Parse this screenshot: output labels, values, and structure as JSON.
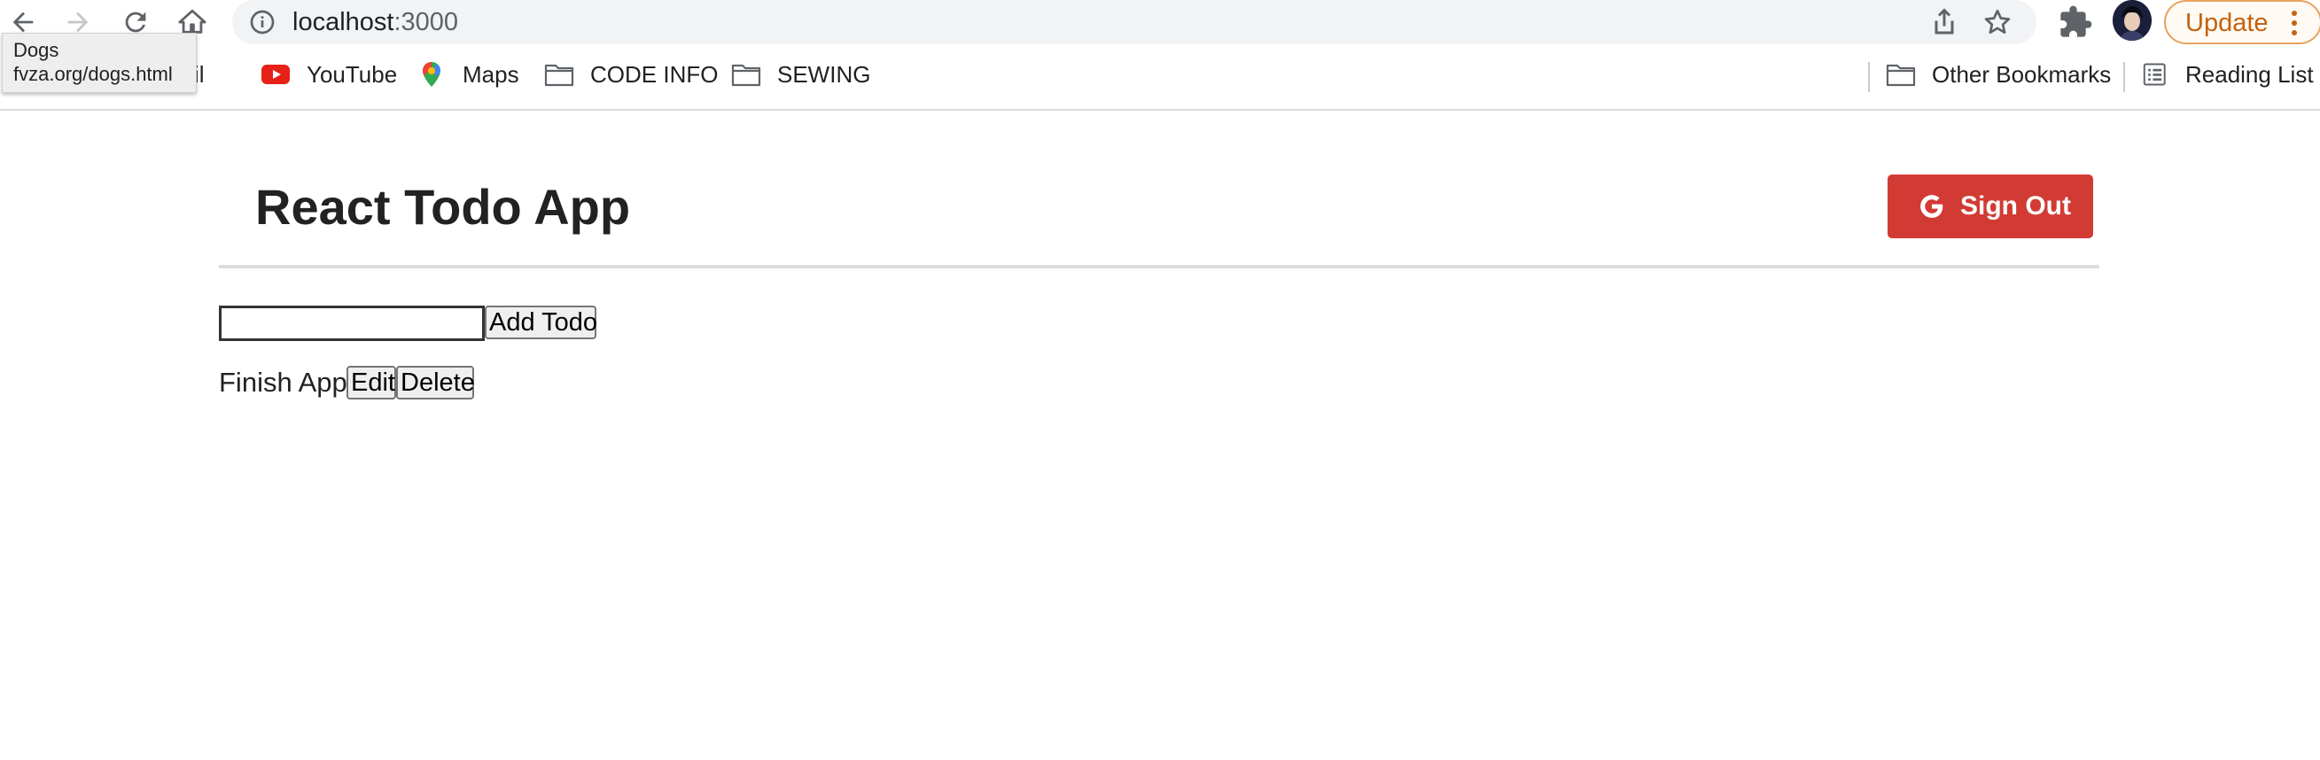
{
  "browser": {
    "url_host": "localhost",
    "url_port": ":3000",
    "update_label": "Update",
    "accent_color": "#c4620f"
  },
  "bookmarks": {
    "items": [
      {
        "label": "nail",
        "icon": "gmail-icon"
      },
      {
        "label": "YouTube",
        "icon": "youtube-icon"
      },
      {
        "label": "Maps",
        "icon": "maps-pin-icon"
      },
      {
        "label": "CODE INFO",
        "icon": "folder-icon"
      },
      {
        "label": "SEWING",
        "icon": "folder-icon"
      }
    ],
    "other_bookmarks": "Other Bookmarks",
    "reading_list": "Reading List"
  },
  "tooltip": {
    "title": "Dogs",
    "url": "fvza.org/dogs.html"
  },
  "app": {
    "title": "React Todo App",
    "sign_out_label": "Sign Out",
    "sign_out_color": "#d13b34",
    "input_value": "",
    "add_button_label": "Add Todo",
    "todos": [
      {
        "text": "Finish App!",
        "edit_label": "Edit",
        "delete_label": "Delete"
      }
    ]
  }
}
